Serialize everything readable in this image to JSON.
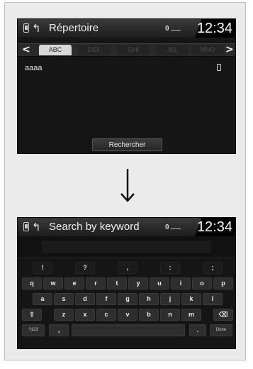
{
  "screen1": {
    "title": "Répertoire",
    "status_indicator": "0",
    "clock": "12:34",
    "tabs": [
      "ABC",
      "DEF",
      "GHI",
      "JKL",
      "MNO"
    ],
    "list_items": [
      "aaaa"
    ],
    "search_button": "Rechercher"
  },
  "screen2": {
    "title": "Search by keyword",
    "status_indicator": "0",
    "clock": "12:34",
    "keyboard": {
      "row0": [
        "!",
        "?",
        ",",
        ":",
        ";"
      ],
      "row1": [
        "q",
        "w",
        "e",
        "r",
        "t",
        "y",
        "u",
        "i",
        "o",
        "p"
      ],
      "row2": [
        "a",
        "s",
        "d",
        "f",
        "g",
        "h",
        "j",
        "k",
        "l"
      ],
      "row3": [
        "z",
        "x",
        "c",
        "v",
        "b",
        "n",
        "m"
      ],
      "shift_key": "⇧",
      "backspace_key": "⌫",
      "symbols_key": "?123",
      "comma_key": ",",
      "period_key": ".",
      "done_key": "Done"
    }
  }
}
